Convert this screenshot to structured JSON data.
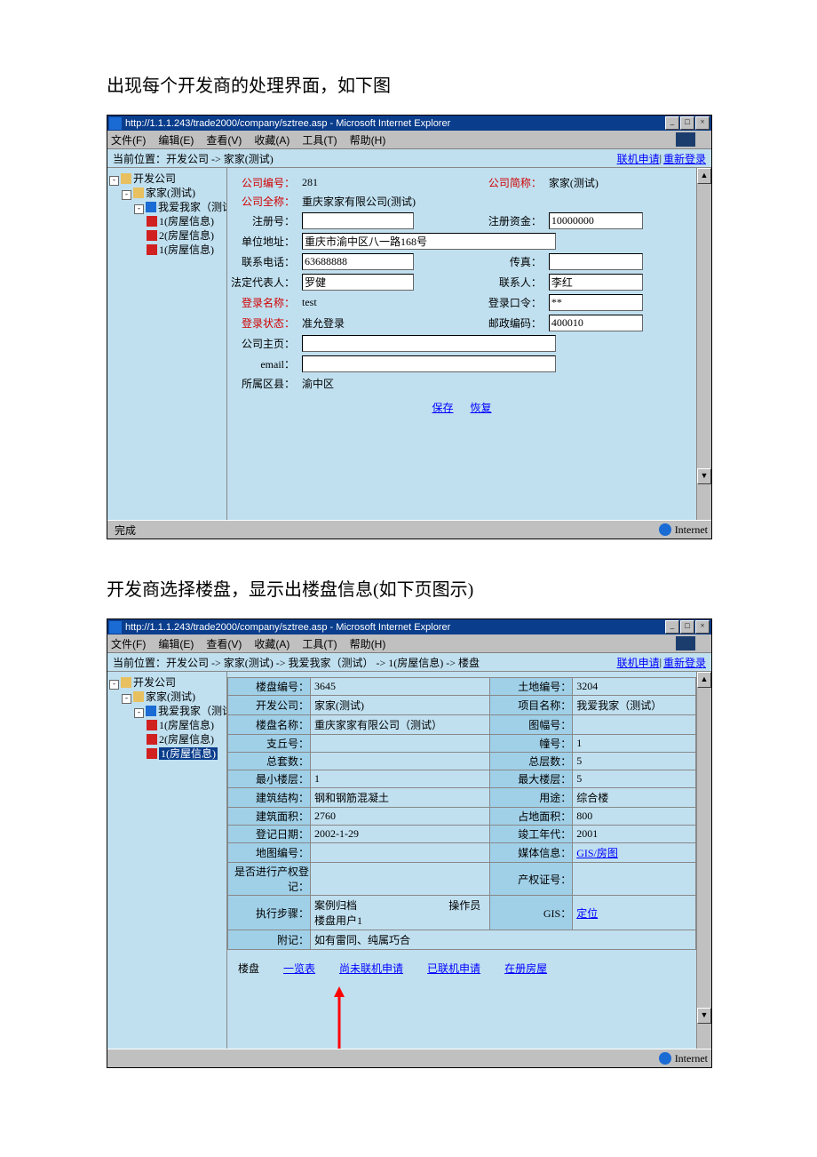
{
  "caption1": "出现每个开发商的处理界面，如下图",
  "caption2": "开发商选择楼盘，显示出楼盘信息(如下页图示)",
  "title": "http://1.1.1.243/trade2000/company/sztree.asp - Microsoft Internet Explorer",
  "menu": [
    "文件(F)",
    "编辑(E)",
    "查看(V)",
    "收藏(A)",
    "工具(T)",
    "帮助(H)"
  ],
  "loc1": "当前位置：开发公司 -> 家家(测试)",
  "loc2": "当前位置：开发公司 -> 家家(测试) -> 我爱我家（测试） -> 1(房屋信息) -> 楼盘",
  "loclinks": [
    "联机申请",
    "重新登录"
  ],
  "tree": [
    "开发公司",
    "家家(测试)",
    "我爱我家（测试）",
    "1(房屋信息)",
    "2(房屋信息)",
    "1(房屋信息)"
  ],
  "form": {
    "id_label": "公司编号：",
    "id": "281",
    "short_label": "公司简称：",
    "short": "家家(测试)",
    "full_label": "公司全称：",
    "full": "重庆家家有限公司(测试)",
    "reg_label": "注册号：",
    "reg": "",
    "cap_label": "注册资金：",
    "cap": "10000000",
    "addr_label": "单位地址：",
    "addr": "重庆市渝中区八一路168号",
    "tel_label": "联系电话：",
    "tel": "63688888",
    "fax_label": "传真：",
    "fax": "",
    "legal_label": "法定代表人：",
    "legal": "罗健",
    "contact_label": "联系人：",
    "contact": "李红",
    "login_label": "登录名称：",
    "login": "test",
    "pwd_label": "登录口令：",
    "pwd": "**",
    "state_label": "登录状态：",
    "state": "准允登录",
    "zip_label": "邮政编码：",
    "zip": "400010",
    "home_label": "公司主页：",
    "home": "",
    "email_label": "email：",
    "email": "",
    "dist_label": "所属区县：",
    "dist": "渝中区",
    "save": "保存",
    "reset": "恢复"
  },
  "det": {
    "l_bno": "楼盘编号：",
    "v_bno": "3645",
    "l_lno": "土地编号：",
    "v_lno": "3204",
    "l_dev": "开发公司：",
    "v_dev": "家家(测试)",
    "l_proj": "项目名称：",
    "v_proj": "我爱我家（测试）",
    "l_bname": "楼盘名称：",
    "v_bname": "重庆家家有限公司（测试）",
    "l_img": "图幅号：",
    "v_img": "",
    "l_zq": "支丘号：",
    "v_zq": "",
    "l_zh": "幢号：",
    "v_zh": "1",
    "l_total": "总套数：",
    "v_total": "",
    "l_floors": "总层数：",
    "v_floors": "5",
    "l_minf": "最小楼层：",
    "v_minf": "1",
    "l_maxf": "最大楼层：",
    "v_maxf": "5",
    "l_struct": "建筑结构：",
    "v_struct": "钢和钢筋混凝土",
    "l_use": "用途：",
    "v_use": "综合楼",
    "l_area": "建筑面积：",
    "v_area": "2760",
    "l_larea": "占地面积：",
    "v_larea": "800",
    "l_regd": "登记日期：",
    "v_regd": "2002-1-29",
    "l_done": "竣工年代：",
    "v_done": "2001",
    "l_map": "地图编号：",
    "v_map": "",
    "l_media": "媒体信息：",
    "v_media": "GIS/房图",
    "l_own": "是否进行产权登记：",
    "v_own": "",
    "l_cert": "产权证号：",
    "v_cert": "",
    "l_step": "执行步骤：",
    "v_step1": "案例归档",
    "v_step2": "楼盘用户1",
    "l_op": "操作员",
    "l_gis": "GIS：",
    "v_gis": "定位",
    "l_note": "附记：",
    "v_note": "如有雷同、纯属巧合"
  },
  "blinks": {
    "hdr": "楼盘",
    "a": "一览表",
    "b": "尚未联机申请",
    "c": "已联机申请",
    "d": "在册房屋"
  },
  "status": {
    "done": "完成",
    "net": "Internet"
  }
}
